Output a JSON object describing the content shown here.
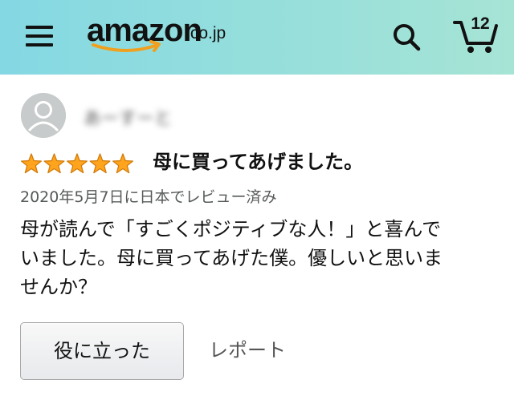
{
  "header": {
    "logo_main": "amazon",
    "logo_tld": ".co.jp",
    "cart_count": "12",
    "menu_icon": "hamburger-menu-icon",
    "search_icon": "search-icon",
    "cart_icon": "cart-icon",
    "gradient": [
      "#84d8e3",
      "#a6e4d5"
    ]
  },
  "review": {
    "reviewer_name": "あーすーと",
    "rating": 5,
    "rating_max": 5,
    "title": "母に買ってあげました。",
    "meta": "2020年5月7日に日本でレビュー済み",
    "body_lines": [
      "母が読んで「すごくポジティブな人！」と喜んで",
      "いました。母に買ってあげた僕。優しいと思いま",
      "せんか？"
    ],
    "helpful_label": "役に立った",
    "report_label": "レポート",
    "star_color": "#ffa41c"
  }
}
